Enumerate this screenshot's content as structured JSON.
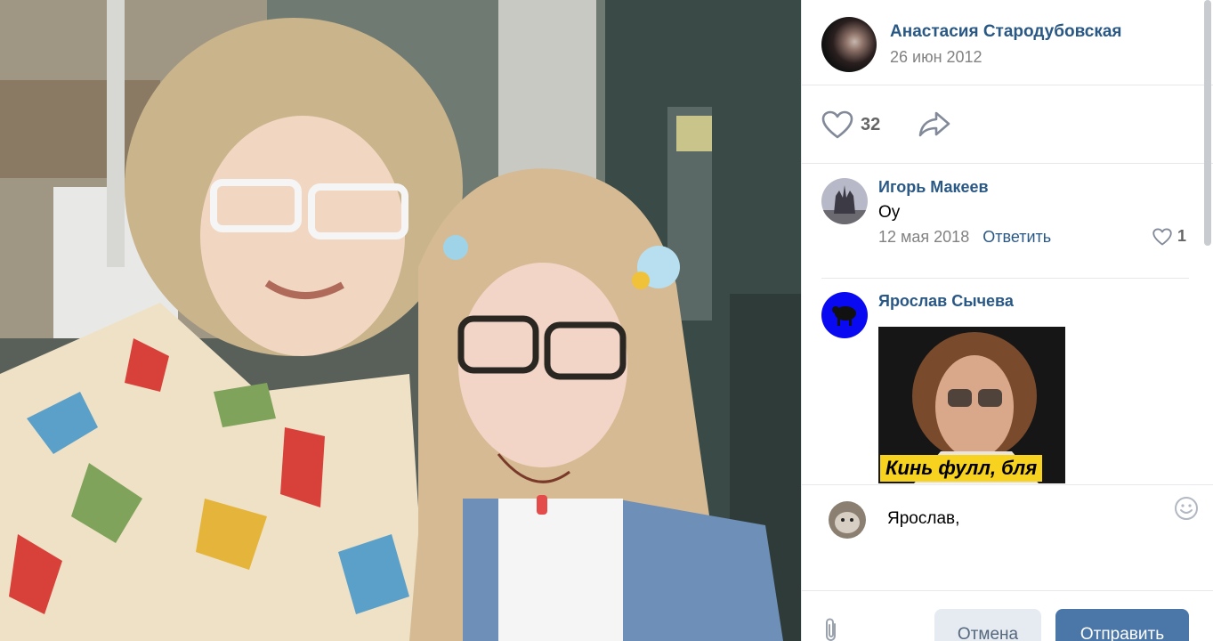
{
  "photo": {
    "icon": "photo-image"
  },
  "post": {
    "author": "Анастасия Стародубовская",
    "date": "26 июн 2012",
    "likes": "32"
  },
  "comments": [
    {
      "author": "Игорь Макеев",
      "text": "Оу",
      "date": "12 мая 2018",
      "reply_label": "Ответить",
      "likes": "1"
    },
    {
      "author": "Ярослав Сычева",
      "sticker_caption": "Кинь фулл, бля"
    }
  ],
  "reply": {
    "value": "Ярослав,",
    "cancel_label": "Отмена",
    "send_label": "Отправить"
  },
  "colors": {
    "link": "#2a5885",
    "accent": "#4a76a8",
    "muted": "#828282"
  }
}
